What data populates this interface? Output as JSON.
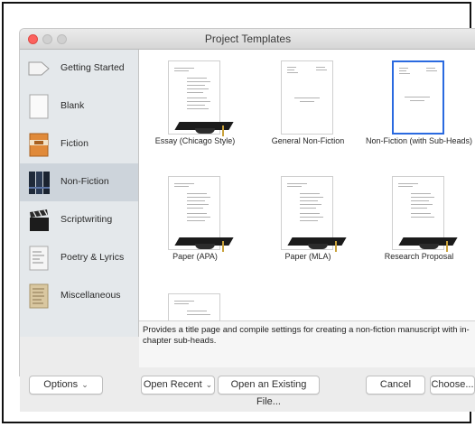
{
  "window": {
    "title": "Project Templates"
  },
  "sidebar": {
    "categories": [
      {
        "label": "Getting Started",
        "icon": "arrow-signpost-icon"
      },
      {
        "label": "Blank",
        "icon": "blank-page-icon"
      },
      {
        "label": "Fiction",
        "icon": "book-icon"
      },
      {
        "label": "Non-Fiction",
        "icon": "books-icon",
        "selected": true
      },
      {
        "label": "Scriptwriting",
        "icon": "clapperboard-icon"
      },
      {
        "label": "Poetry & Lyrics",
        "icon": "poem-page-icon"
      },
      {
        "label": "Miscellaneous",
        "icon": "parchment-icon"
      }
    ]
  },
  "templates": [
    {
      "label": "Essay (Chicago Style)",
      "cap": true
    },
    {
      "label": "General Non-Fiction",
      "cap": false
    },
    {
      "label": "Non-Fiction (with Sub-Heads)",
      "cap": false,
      "selected": true
    },
    {
      "label": "Paper (APA)",
      "cap": true
    },
    {
      "label": "Paper (MLA)",
      "cap": true
    },
    {
      "label": "Research Proposal",
      "cap": true
    }
  ],
  "description": "Provides a title page and compile settings for creating a non-fiction manuscript with in-chapter sub-heads.",
  "buttons": {
    "options": "Options",
    "open_recent": "Open Recent",
    "open_existing": "Open an Existing File...",
    "cancel": "Cancel",
    "choose": "Choose..."
  },
  "colors": {
    "selection_border": "#2a6ae0",
    "sidebar_selected": "#cdd4db",
    "close_button": "#fc615d"
  }
}
